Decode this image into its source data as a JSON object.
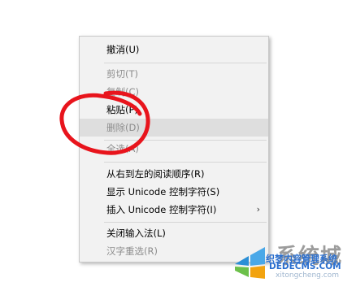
{
  "context_menu": {
    "items": [
      {
        "label": "撤消(U)",
        "enabled": true
      },
      {
        "label": "剪切(T)",
        "enabled": false
      },
      {
        "label": "复制(C)",
        "enabled": false
      },
      {
        "label": "粘贴(P)",
        "enabled": true
      },
      {
        "label": "删除(D)",
        "enabled": false,
        "highlighted": true
      },
      {
        "label": "全选(A)",
        "enabled": false
      },
      {
        "label": "从右到左的阅读顺序(R)",
        "enabled": true
      },
      {
        "label": "显示 Unicode 控制字符(S)",
        "enabled": true
      },
      {
        "label": "插入 Unicode 控制字符(I)",
        "enabled": true,
        "submenu_arrow": "›"
      },
      {
        "label": "关闭输入法(L)",
        "enabled": true
      },
      {
        "label": "汉字重选(R)",
        "enabled": false
      }
    ]
  },
  "annotation": {
    "color": "#e8141c"
  },
  "watermark": {
    "brand": "系统城",
    "line1": "织梦内容管理系统",
    "line2": "DEDECMS.COM",
    "line3": "xitongcheng.com"
  }
}
